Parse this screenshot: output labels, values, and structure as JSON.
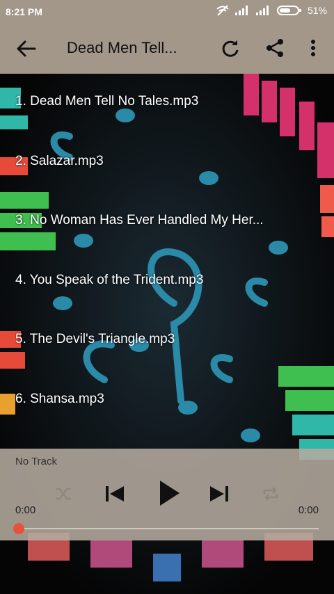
{
  "status_bar": {
    "time": "8:21 PM",
    "battery_percent": "51%"
  },
  "app_bar": {
    "title": "Dead Men Tell..."
  },
  "tracks": [
    {
      "label": "1. Dead Men Tell No Tales.mp3"
    },
    {
      "label": "2. Salazar.mp3"
    },
    {
      "label": "3. No Woman Has Ever Handled My Her..."
    },
    {
      "label": "4. You Speak of the Trident.mp3"
    },
    {
      "label": "5. The Devil's Triangle.mp3"
    },
    {
      "label": "6. Shansa.mp3"
    }
  ],
  "player": {
    "now_playing": "No Track",
    "current_time": "0:00",
    "duration": "0:00",
    "progress": 0
  },
  "colors": {
    "appbar": "#a3978a",
    "accent": "#e5533a"
  },
  "icons": [
    "back-arrow-icon",
    "refresh-icon",
    "share-icon",
    "more-vert-icon",
    "shuffle-icon",
    "skip-previous-icon",
    "play-icon",
    "skip-next-icon",
    "repeat-icon",
    "wifi-off-icon",
    "signal-icon",
    "battery-icon"
  ]
}
